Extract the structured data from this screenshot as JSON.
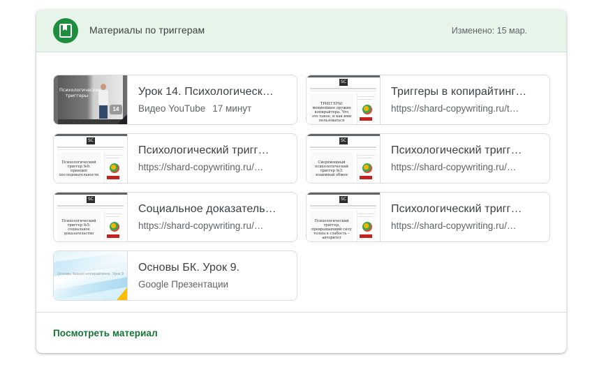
{
  "header": {
    "title": "Материалы по триггерам",
    "meta": "Изменено: 15 мар."
  },
  "tiles": [
    {
      "title": "Урок 14. Психологическ…",
      "source": "Видео YouTube",
      "duration": "17 минут",
      "thumb": "video",
      "thumb_caption": "Психологические триггеры",
      "thumb_badge": "14"
    },
    {
      "title": "Триггеры в копирайтинг…",
      "source": "https://shard-copywriting.ru/t…",
      "thumb": "website",
      "thumb_text": "ТРИГГЕРЫ: мощнейшее оружие копирайтера. Что это такое, и как ими пользоваться"
    },
    {
      "title": "Психологический тригг…",
      "source": "https://shard-copywriting.ru/…",
      "thumb": "website",
      "thumb_text": "Психологический триггер №6: принцип последовательности"
    },
    {
      "title": "Психологический тригг…",
      "source": "https://shard-copywriting.ru/…",
      "thumb": "website",
      "thumb_text": "Сверхмощный психологический триггер №3: взаимный обмен"
    },
    {
      "title": "Социальное доказатель…",
      "source": "https://shard-copywriting.ru/…",
      "thumb": "website",
      "thumb_text": "Психологический триггер №5: социальное доказательство"
    },
    {
      "title": "Психологический тригг…",
      "source": "https://shard-copywriting.ru/…",
      "thumb": "website",
      "thumb_text": "Психологический триггер, превращающий силу толпы в слабость – авторитет"
    },
    {
      "title": "Основы БК. Урок 9.",
      "source": "Google Презентации",
      "thumb": "slides",
      "thumb_text": "Основы бизнес-копирайтинга. Урок 9"
    }
  ],
  "footer": {
    "link_label": "Посмотреть материал"
  },
  "colors": {
    "header_bg": "#e6f4ea",
    "accent_green": "#1e8e3e",
    "link_green": "#137333"
  },
  "icons": {
    "header": "bookmark-icon"
  }
}
